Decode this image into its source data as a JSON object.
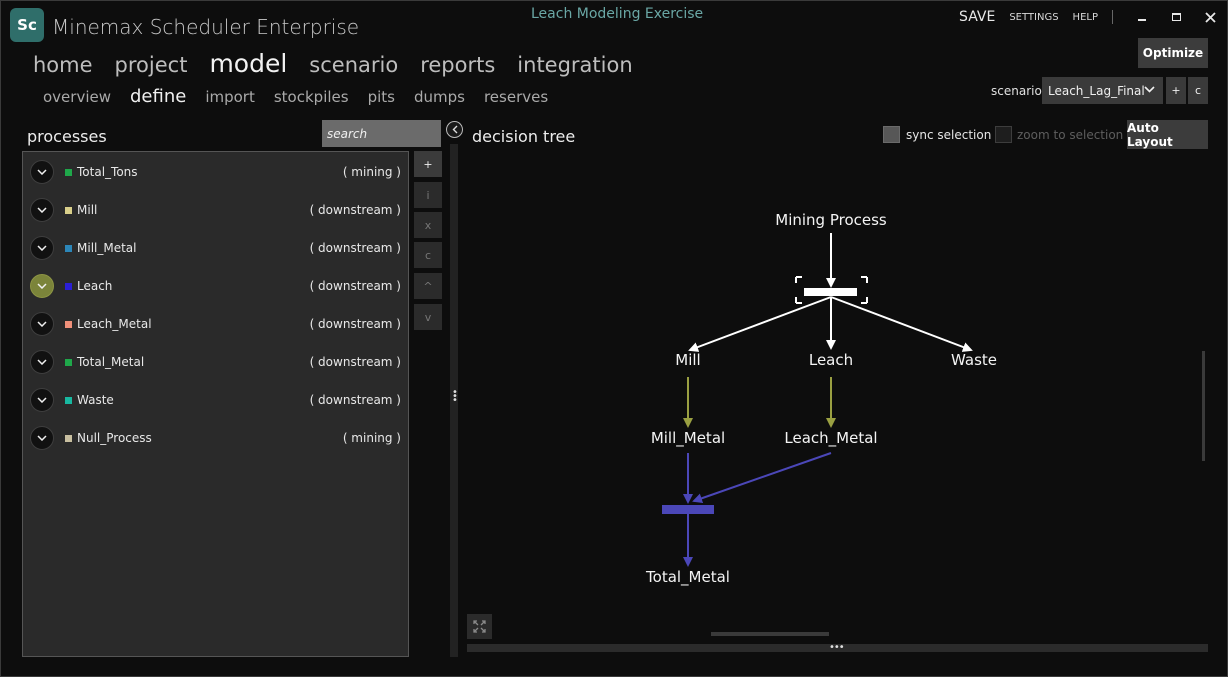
{
  "app": {
    "logo_text": "Sc",
    "title": "Minemax Scheduler Enterprise",
    "window_title": "Leach Modeling Exercise",
    "save_label": "SAVE",
    "settings_label": "SETTINGS",
    "help_label": "HELP"
  },
  "nav": {
    "main": [
      "home",
      "project",
      "model",
      "scenario",
      "reports",
      "integration"
    ],
    "main_active": "model",
    "sub": [
      "overview",
      "define",
      "import",
      "stockpiles",
      "pits",
      "dumps",
      "reserves"
    ],
    "sub_active": "define"
  },
  "toolbar": {
    "optimize_label": "Optimize",
    "scenario_label": "scenario",
    "scenario_value": "Leach_Lag_Final",
    "add_label": "+",
    "copy_label": "c"
  },
  "processes": {
    "title": "processes",
    "search_placeholder": "search",
    "items": [
      {
        "name": "Total_Tons",
        "type": "( mining )",
        "color": "#1fa84a",
        "expanded": false
      },
      {
        "name": "Mill",
        "type": "( downstream )",
        "color": "#d9cf8a",
        "expanded": false
      },
      {
        "name": "Mill_Metal",
        "type": "( downstream )",
        "color": "#2c86b8",
        "expanded": false
      },
      {
        "name": "Leach",
        "type": "( downstream )",
        "color": "#2b1fd6",
        "expanded": true
      },
      {
        "name": "Leach_Metal",
        "type": "( downstream )",
        "color": "#f0907a",
        "expanded": false
      },
      {
        "name": "Total_Metal",
        "type": "( downstream )",
        "color": "#1fa84a",
        "expanded": false
      },
      {
        "name": "Waste",
        "type": "( downstream )",
        "color": "#18b8a0",
        "expanded": false
      },
      {
        "name": "Null_Process",
        "type": "( mining )",
        "color": "#c8bfa0",
        "expanded": false
      }
    ],
    "tools": [
      "+",
      "i",
      "x",
      "c",
      "^",
      "v"
    ]
  },
  "decision_tree": {
    "title": "decision tree",
    "sync_selection_label": "sync selection",
    "zoom_selection_label": "zoom to selection",
    "auto_layout_label": "Auto Layout",
    "nodes": {
      "mining_process": "Mining Process",
      "mill": "Mill",
      "leach": "Leach",
      "waste": "Waste",
      "mill_metal": "Mill_Metal",
      "leach_metal": "Leach_Metal",
      "total_metal": "Total_Metal"
    },
    "colors": {
      "split": "#ffffff",
      "flow": "#9aa042",
      "sum": "#4b47b8"
    }
  }
}
